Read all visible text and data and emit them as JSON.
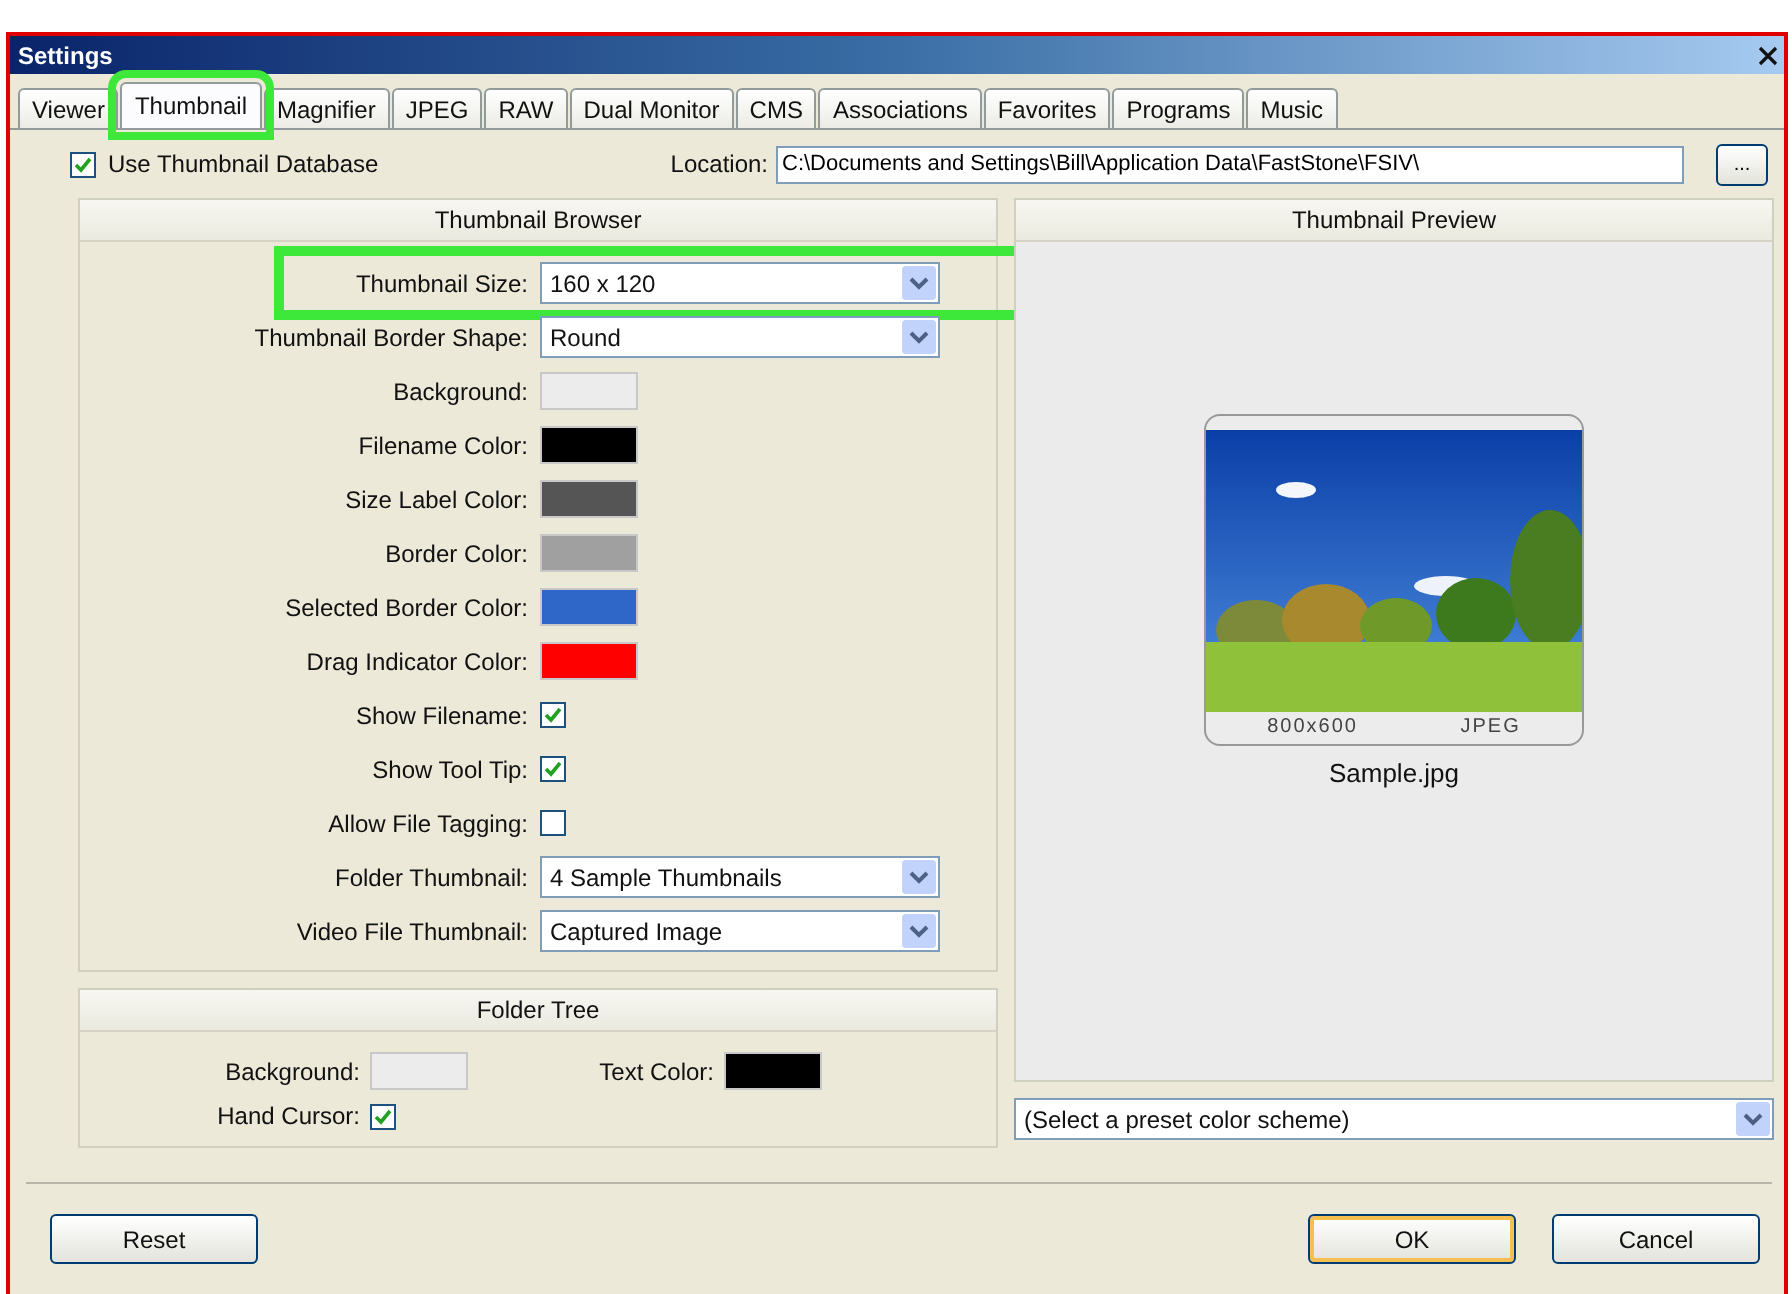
{
  "window": {
    "title": "Settings"
  },
  "tabs": [
    {
      "label": "Viewer",
      "selected": false,
      "highlighted": false
    },
    {
      "label": "Thumbnail",
      "selected": true,
      "highlighted": true
    },
    {
      "label": "Magnifier",
      "selected": false,
      "highlighted": false
    },
    {
      "label": "JPEG",
      "selected": false,
      "highlighted": false
    },
    {
      "label": "RAW",
      "selected": false,
      "highlighted": false
    },
    {
      "label": "Dual Monitor",
      "selected": false,
      "highlighted": false
    },
    {
      "label": "CMS",
      "selected": false,
      "highlighted": false
    },
    {
      "label": "Associations",
      "selected": false,
      "highlighted": false
    },
    {
      "label": "Favorites",
      "selected": false,
      "highlighted": false
    },
    {
      "label": "Programs",
      "selected": false,
      "highlighted": false
    },
    {
      "label": "Music",
      "selected": false,
      "highlighted": false
    }
  ],
  "use_database": {
    "label": "Use Thumbnail Database",
    "checked": true
  },
  "location": {
    "label": "Location:",
    "value": "C:\\Documents and Settings\\Bill\\Application Data\\FastStone\\FSIV\\",
    "browse": "..."
  },
  "thumbnail_browser": {
    "title": "Thumbnail Browser",
    "rows": [
      {
        "kind": "select",
        "label": "Thumbnail Size:",
        "value": "160 x 120",
        "highlighted": true
      },
      {
        "kind": "select",
        "label": "Thumbnail Border Shape:",
        "value": "Round",
        "highlighted": false
      },
      {
        "kind": "swatch",
        "label": "Background:",
        "color": "#ececec",
        "highlighted": false
      },
      {
        "kind": "swatch",
        "label": "Filename Color:",
        "color": "#000000",
        "highlighted": false
      },
      {
        "kind": "swatch",
        "label": "Size Label Color:",
        "color": "#555555",
        "highlighted": false
      },
      {
        "kind": "swatch",
        "label": "Border Color:",
        "color": "#a0a0a0",
        "highlighted": false
      },
      {
        "kind": "swatch",
        "label": "Selected Border Color:",
        "color": "#2f67c8",
        "highlighted": false
      },
      {
        "kind": "swatch",
        "label": "Drag Indicator Color:",
        "color": "#ff0000",
        "highlighted": false
      },
      {
        "kind": "checkbox",
        "label": "Show Filename:",
        "checked": true,
        "highlighted": false
      },
      {
        "kind": "checkbox",
        "label": "Show Tool Tip:",
        "checked": true,
        "highlighted": false
      },
      {
        "kind": "checkbox",
        "label": "Allow File Tagging:",
        "checked": false,
        "highlighted": false
      },
      {
        "kind": "select",
        "label": "Folder Thumbnail:",
        "value": "4 Sample Thumbnails",
        "highlighted": false
      },
      {
        "kind": "select",
        "label": "Video File Thumbnail:",
        "value": "Captured Image",
        "highlighted": false
      }
    ]
  },
  "folder_tree": {
    "title": "Folder Tree",
    "background": {
      "label": "Background:",
      "color": "#ececec"
    },
    "text_color": {
      "label": "Text Color:",
      "color": "#000000"
    },
    "hand_cursor": {
      "label": "Hand Cursor:",
      "checked": true
    }
  },
  "thumbnail_preview": {
    "title": "Thumbnail Preview",
    "dimensions": "800x600",
    "format": "JPEG",
    "filename": "Sample.jpg"
  },
  "color_scheme": {
    "value": "(Select a preset color scheme)"
  },
  "buttons": {
    "reset": "Reset",
    "ok": "OK",
    "cancel": "Cancel"
  }
}
